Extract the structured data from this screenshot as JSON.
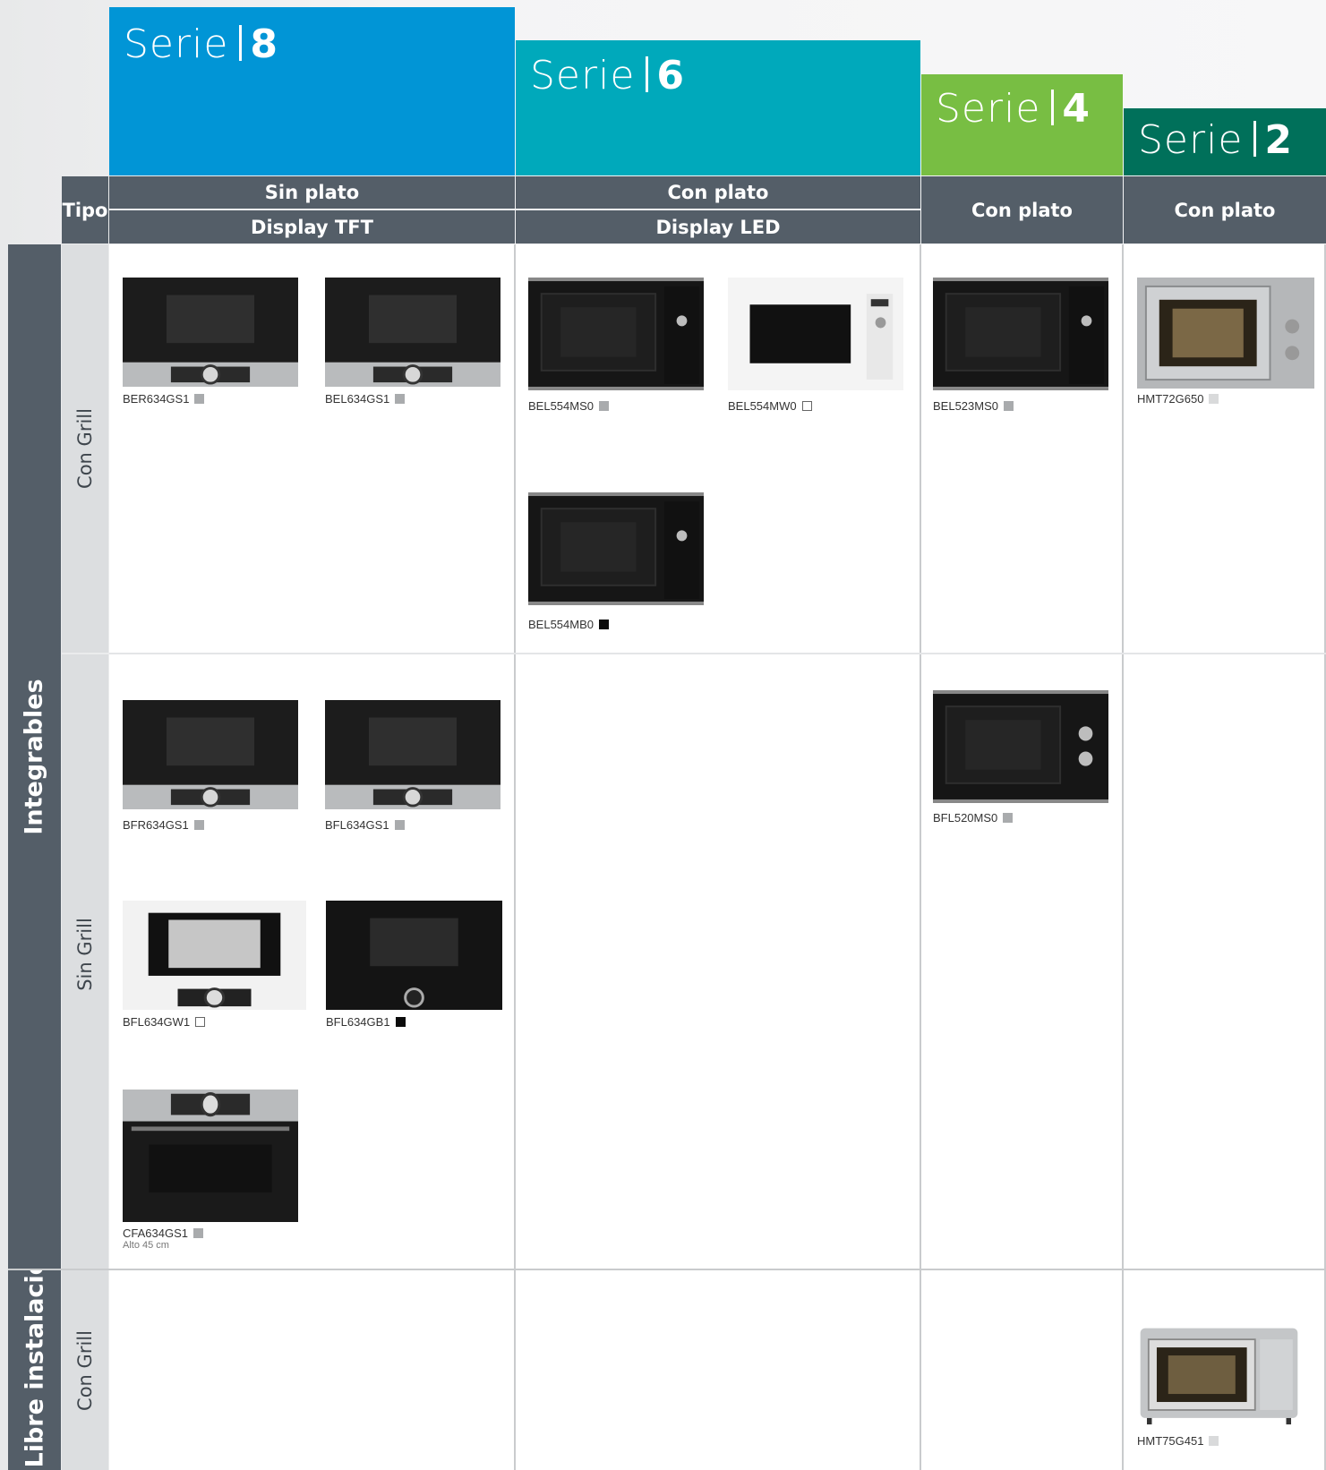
{
  "series": [
    {
      "word": "Serie",
      "number": "8",
      "color": "#0195d6"
    },
    {
      "word": "Serie",
      "number": "6",
      "color": "#00a9bb"
    },
    {
      "word": "Serie",
      "number": "4",
      "color": "#78be43"
    },
    {
      "word": "Serie",
      "number": "2",
      "color": "#00705a"
    }
  ],
  "header": {
    "tipo": "Tipo",
    "serie8": {
      "row1": "Sin plato",
      "row2": "Display TFT"
    },
    "serie6": {
      "row1": "Con plato",
      "row2": "Display LED"
    },
    "serie4": "Con plato",
    "serie2": "Con plato"
  },
  "groups": {
    "integrables": "Integrables",
    "libre": "Libre instalación"
  },
  "subgroups": {
    "con_grill": "Con Grill",
    "sin_grill": "Sin Grill",
    "libre_con_grill": "Con Grill"
  },
  "products": [
    {
      "model": "BER634GS1",
      "finish": "grey",
      "style": "s8-top"
    },
    {
      "model": "BEL634GS1",
      "finish": "grey",
      "style": "s8-top"
    },
    {
      "model": "BEL554MS0",
      "finish": "grey",
      "style": "s6-black"
    },
    {
      "model": "BEL554MW0",
      "finish": "white",
      "style": "s6-white"
    },
    {
      "model": "BEL554MB0",
      "finish": "black",
      "style": "s6-black"
    },
    {
      "model": "BEL523MS0",
      "finish": "grey",
      "style": "s6-black"
    },
    {
      "model": "HMT72G650",
      "finish": "light",
      "style": "s2-steel"
    },
    {
      "model": "BFR634GS1",
      "finish": "grey",
      "style": "s8-top"
    },
    {
      "model": "BFL634GS1",
      "finish": "grey",
      "style": "s8-top"
    },
    {
      "model": "BFL634GW1",
      "finish": "white",
      "style": "s8-white"
    },
    {
      "model": "BFL634GB1",
      "finish": "black",
      "style": "s8-blackfull"
    },
    {
      "model": "CFA634GS1",
      "finish": "grey",
      "style": "s8-compact",
      "note": "Alto 45 cm"
    },
    {
      "model": "BFL520MS0",
      "finish": "grey",
      "style": "s4-knobs"
    },
    {
      "model": "HMT75G451",
      "finish": "light",
      "style": "s2-free"
    }
  ]
}
